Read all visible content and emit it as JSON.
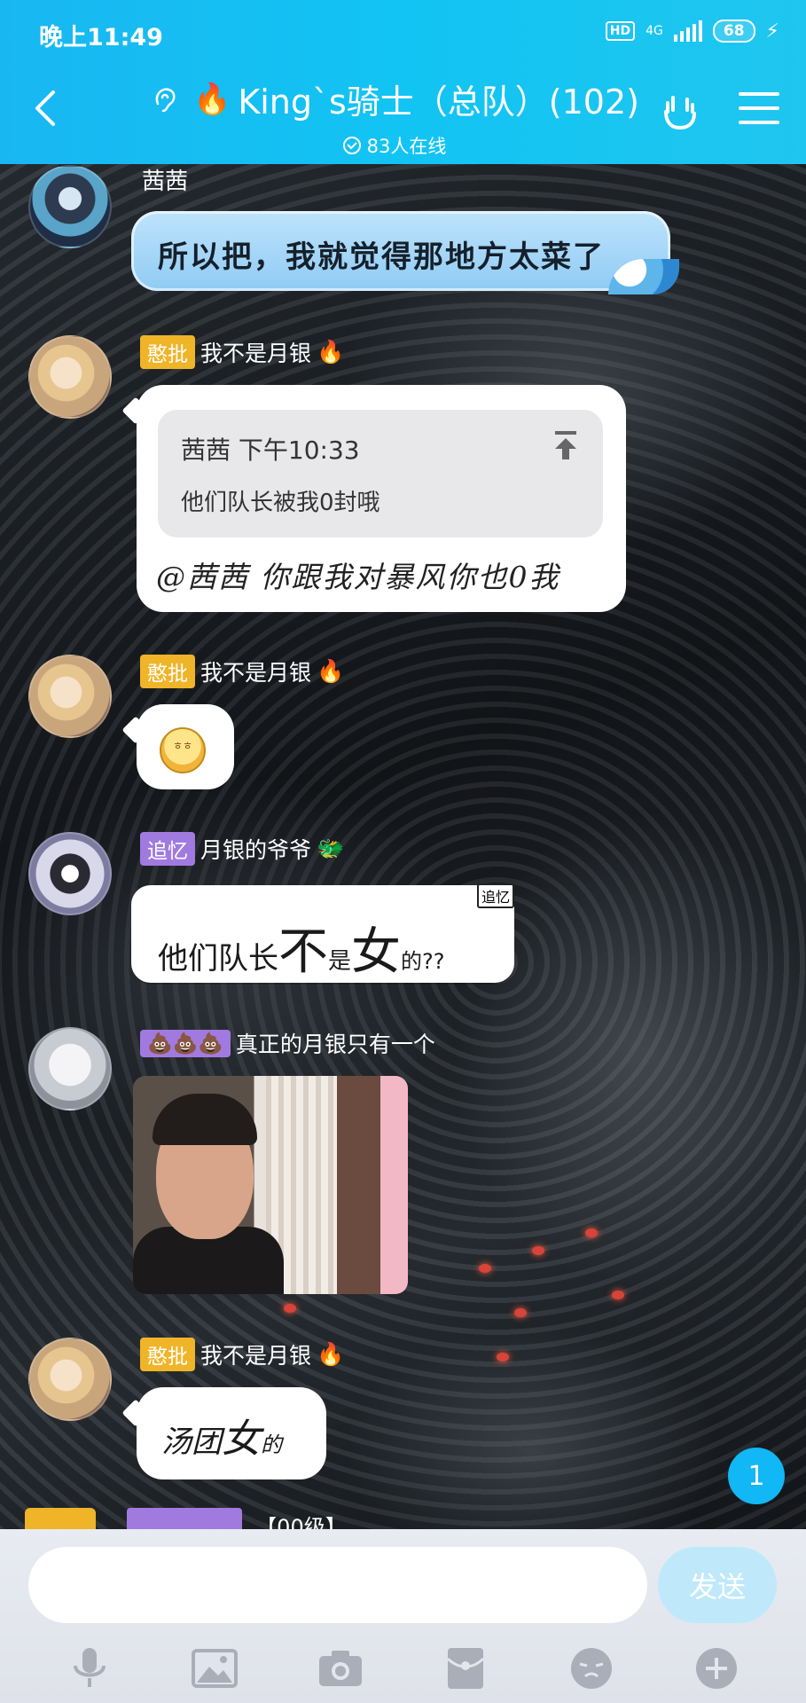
{
  "status_bar": {
    "time": "晚上11:49",
    "hd": "HD",
    "network": "4G",
    "battery": "68"
  },
  "header": {
    "title": "King`s骑士（总队）(102)",
    "online": "83人在线"
  },
  "messages": [
    {
      "sender": "茜茜",
      "text": "所以把，我就觉得那地方太菜了"
    },
    {
      "tag": "憨批",
      "sender": "我不是月银",
      "quote_header": "茜茜 下午10:33",
      "quote_text": "他们队长被我0封哦",
      "text": "@茜茜 你跟我对暴风你也0我"
    },
    {
      "tag": "憨批",
      "sender": "我不是月银",
      "emoji_text": "ㅎㅎ"
    },
    {
      "tag": "追忆",
      "sender": "月银的爷爷",
      "sticker_tag": "追忆",
      "text_parts": [
        "他们队长",
        "不",
        "是",
        "女",
        "的??"
      ]
    },
    {
      "tag": "💩💩💩",
      "sender": "真正的月银只有一个"
    },
    {
      "tag": "憨批",
      "sender": "我不是月银",
      "text_parts": [
        "汤团",
        "女",
        "的"
      ]
    }
  ],
  "unread_count": "1",
  "peek_text": "【00级】",
  "input": {
    "value": "",
    "send_label": "发送"
  }
}
